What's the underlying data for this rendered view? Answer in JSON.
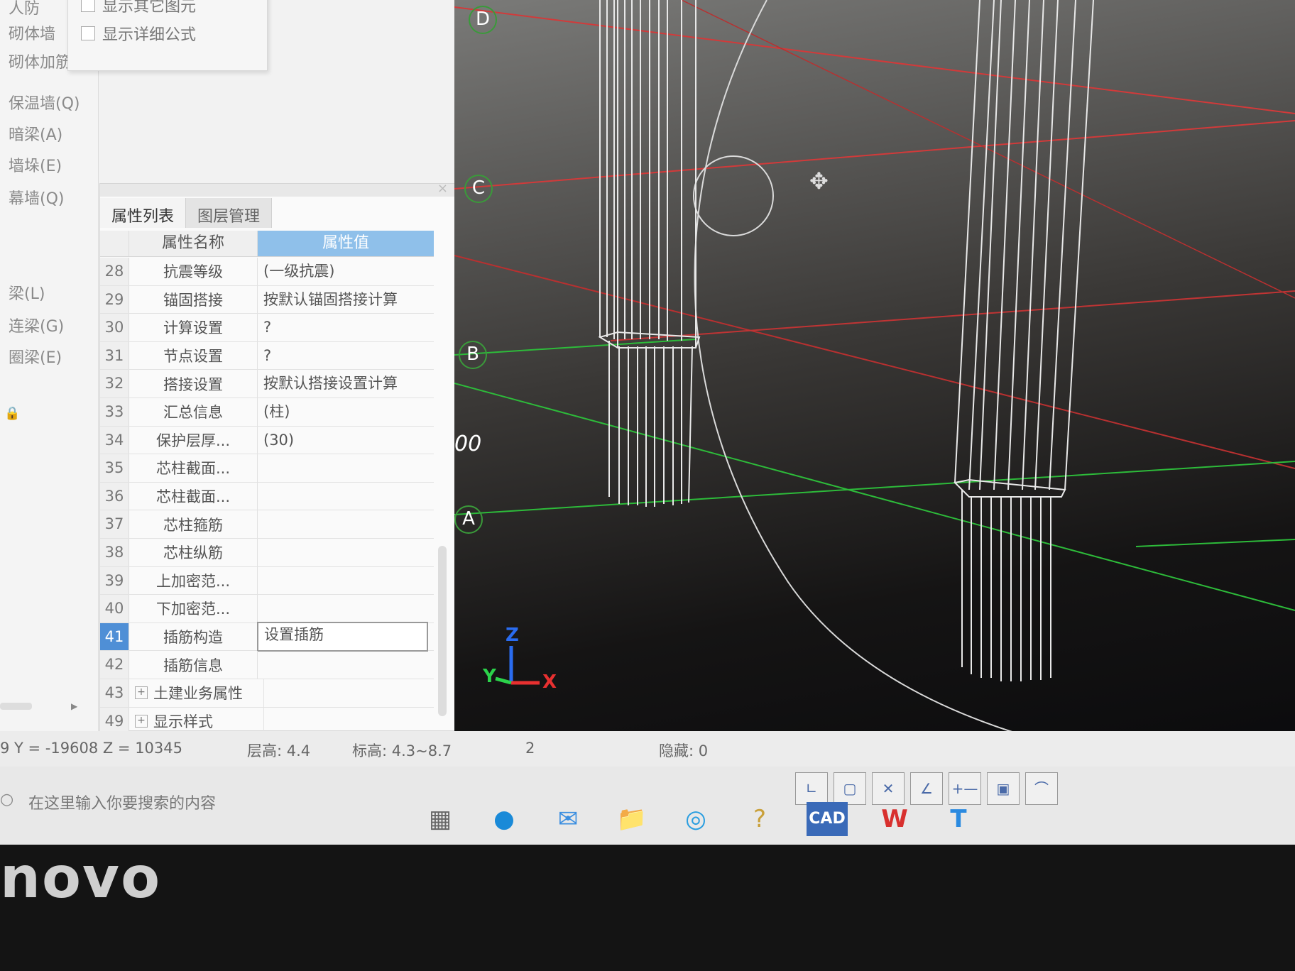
{
  "left_nav": {
    "items": [
      "人防",
      "砌体墙",
      "砌体加筋(Y)",
      "保温墙(Q)",
      "暗梁(A)",
      "墙垛(E)",
      "幕墙(Q)",
      "梁(L)",
      "连梁(G)",
      "圈梁(E)"
    ]
  },
  "popup": {
    "options": [
      "显示其它图元",
      "显示详细公式"
    ]
  },
  "panel": {
    "tabs": [
      "属性列表",
      "图层管理"
    ],
    "col_name": "属性名称",
    "col_value": "属性值",
    "rows": [
      {
        "num": "28",
        "name": "抗震等级",
        "value": "(一级抗震)"
      },
      {
        "num": "29",
        "name": "锚固搭接",
        "value": "按默认锚固搭接计算"
      },
      {
        "num": "30",
        "name": "计算设置",
        "value": "?"
      },
      {
        "num": "31",
        "name": "节点设置",
        "value": "?"
      },
      {
        "num": "32",
        "name": "搭接设置",
        "value": "按默认搭接设置计算"
      },
      {
        "num": "33",
        "name": "汇总信息",
        "value": "(柱)"
      },
      {
        "num": "34",
        "name": "保护层厚...",
        "value": "(30)"
      },
      {
        "num": "35",
        "name": "芯柱截面...",
        "value": ""
      },
      {
        "num": "36",
        "name": "芯柱截面...",
        "value": ""
      },
      {
        "num": "37",
        "name": "芯柱箍筋",
        "value": ""
      },
      {
        "num": "38",
        "name": "芯柱纵筋",
        "value": ""
      },
      {
        "num": "39",
        "name": "上加密范...",
        "value": ""
      },
      {
        "num": "40",
        "name": "下加密范...",
        "value": ""
      },
      {
        "num": "41",
        "name": "插筋构造",
        "value": "设置插筋"
      },
      {
        "num": "42",
        "name": "插筋信息",
        "value": ""
      },
      {
        "num": "43",
        "name": "土建业务属性",
        "value": ""
      },
      {
        "num": "49",
        "name": "显示样式",
        "value": ""
      }
    ]
  },
  "viewport": {
    "axis_labels": [
      "D",
      "C",
      "B",
      "A"
    ],
    "partial_text": "00",
    "coord_axes": {
      "z": "Z",
      "y": "Y",
      "x": "X"
    }
  },
  "status": {
    "coords": "9 Y = -19608 Z = 10345",
    "floor_height": "层高:  4.4",
    "elevation": "标高:  4.3~8.7",
    "count": "2",
    "hidden": "隐藏:  0"
  },
  "taskbar": {
    "search_placeholder": "在这里输入你要搜索的内容",
    "cad_label": "CAD",
    "t_label": "T"
  },
  "brand": "novo"
}
